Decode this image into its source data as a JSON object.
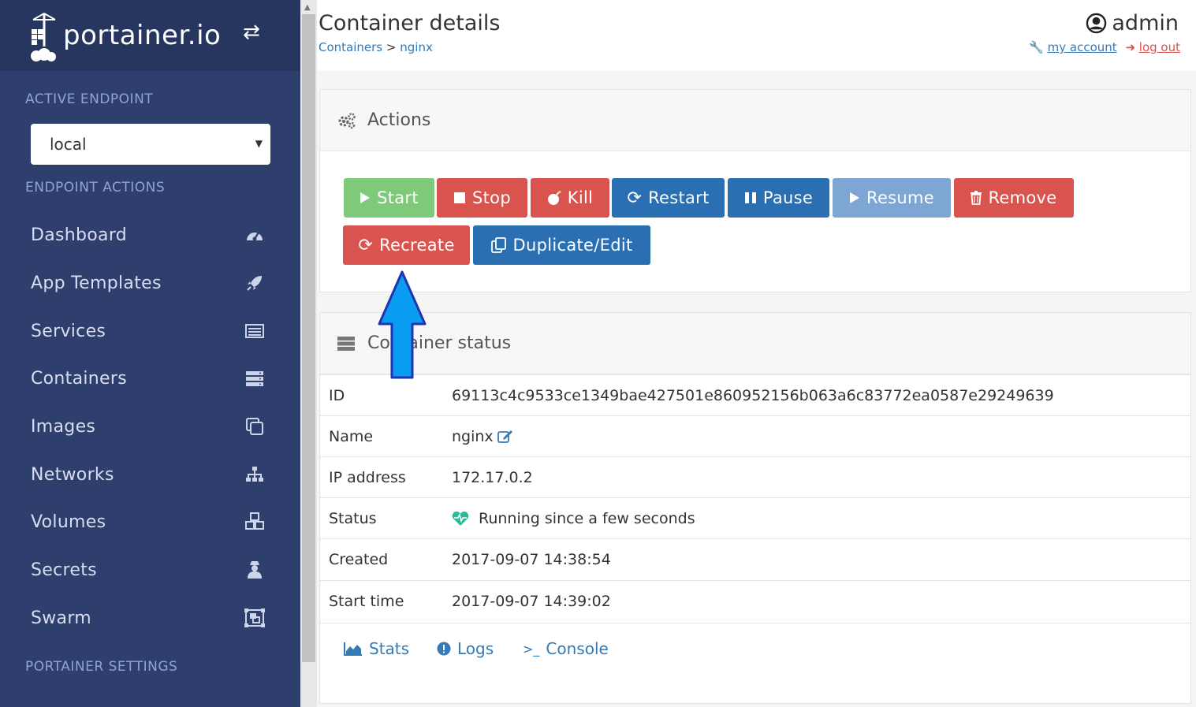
{
  "sidebar": {
    "brand": "portainer.io",
    "active_endpoint_label": "ACTIVE ENDPOINT",
    "endpoint_value": "local",
    "endpoint_actions_label": "ENDPOINT ACTIONS",
    "items": [
      {
        "label": "Dashboard",
        "icon": "tachometer-icon"
      },
      {
        "label": "App Templates",
        "icon": "rocket-icon"
      },
      {
        "label": "Services",
        "icon": "list-alt-icon"
      },
      {
        "label": "Containers",
        "icon": "server-icon"
      },
      {
        "label": "Images",
        "icon": "clone-icon"
      },
      {
        "label": "Networks",
        "icon": "sitemap-icon"
      },
      {
        "label": "Volumes",
        "icon": "cubes-icon"
      },
      {
        "label": "Secrets",
        "icon": "user-secret-icon"
      },
      {
        "label": "Swarm",
        "icon": "object-group-icon"
      }
    ],
    "portainer_settings_label": "PORTAINER SETTINGS"
  },
  "header": {
    "title": "Container details",
    "breadcrumb_parent": "Containers",
    "breadcrumb_sep": ">",
    "breadcrumb_current": "nginx",
    "user": "admin",
    "my_account": "my account",
    "log_out": "log out"
  },
  "actions": {
    "title": "Actions",
    "start": "Start",
    "stop": "Stop",
    "kill": "Kill",
    "restart": "Restart",
    "pause": "Pause",
    "resume": "Resume",
    "remove": "Remove",
    "recreate": "Recreate",
    "duplicate_edit": "Duplicate/Edit"
  },
  "status": {
    "title": "Container status",
    "rows": [
      {
        "key": "ID",
        "value": "69113c4c9533ce1349bae427501e860952156b063a6c83772ea0587e29249639"
      },
      {
        "key": "Name",
        "value": "nginx"
      },
      {
        "key": "IP address",
        "value": "172.17.0.2"
      },
      {
        "key": "Status",
        "value": "Running since a few seconds"
      },
      {
        "key": "Created",
        "value": "2017-09-07 14:38:54"
      },
      {
        "key": "Start time",
        "value": "2017-09-07 14:39:02"
      }
    ],
    "tabs": {
      "stats": "Stats",
      "logs": "Logs",
      "console": "Console"
    }
  },
  "colors": {
    "sidebar_bg": "#2e3f6e",
    "success": "#7fc97a",
    "danger": "#d9534f",
    "primary": "#2b6fb3",
    "link": "#337ab7",
    "annotation_arrow": "#0a9cf0"
  }
}
